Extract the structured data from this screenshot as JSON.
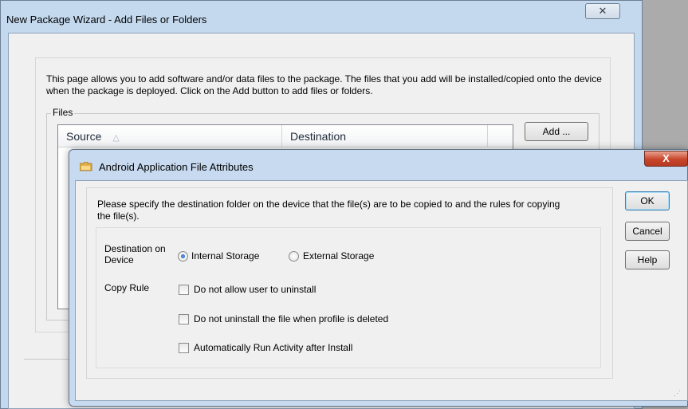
{
  "wizard": {
    "title": "New Package Wizard - Add Files or Folders",
    "close_glyph": "✕",
    "description": "This page allows you to add software and/or data files to the package. The files that you add will be installed/copied onto the device when the package is deployed. Click on the Add button to add files or folders.",
    "files_group_label": "Files",
    "columns": {
      "source": "Source",
      "destination": "Destination"
    },
    "sort_glyph": "△",
    "add_label": "Add ..."
  },
  "dialog": {
    "title": "Android Application File Attributes",
    "icon": "folder-icon",
    "close_glyph": "X",
    "description": "Please specify the destination folder on the device that the file(s) are to be copied to and the rules for copying the file(s).",
    "destination_label": "Destination on Device",
    "destination_options": [
      {
        "label": "Internal Storage",
        "selected": true
      },
      {
        "label": "External Storage",
        "selected": false
      }
    ],
    "copy_rule_label": "Copy Rule",
    "copy_rules": [
      {
        "label": "Do not allow user to uninstall",
        "checked": false
      },
      {
        "label": "Do not uninstall the file when profile is deleted",
        "checked": false
      },
      {
        "label": "Automatically Run Activity after Install",
        "checked": false
      }
    ],
    "buttons": {
      "ok": "OK",
      "cancel": "Cancel",
      "help": "Help"
    }
  },
  "colors": {
    "window_frame": "#c4d9ee",
    "dialog_frame": "#c7daf0",
    "close_button_red": "#c8462b",
    "desktop": "#ababab"
  }
}
